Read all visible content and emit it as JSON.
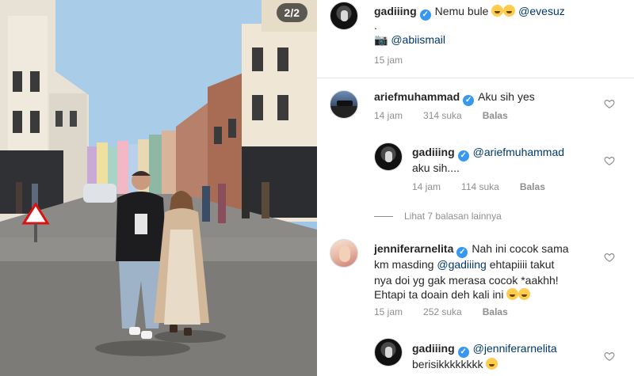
{
  "photo": {
    "counter": "2/2"
  },
  "post": {
    "username": "gadiiing",
    "caption_text": "Nemu bule",
    "caption_mention": "@evesuz",
    "dot": ".",
    "credit_mention": "@abiismail",
    "time": "15 jam"
  },
  "comments": [
    {
      "username": "ariefmuhammad",
      "text": "Aku sih yes",
      "time": "14 jam",
      "likes": "314 suka",
      "reply": "Balas",
      "replies": [
        {
          "username": "gadiiing",
          "mention": "@ariefmuhammad",
          "text": "aku sih....",
          "time": "14 jam",
          "likes": "114 suka",
          "reply": "Balas"
        }
      ],
      "view_more": "Lihat 7 balasan lainnya"
    },
    {
      "username": "jenniferarnelita",
      "text_line1": "Nah ini cocok sama",
      "text_line2_a": "km masding",
      "text_line2_mention": "@gadiiing",
      "text_line2_b": "ehtapiiii takut",
      "text_line3": "nya doi yg gak merasa cocok *aakhh!",
      "text_line4": "Ehtapi ta doain  deh kali ini",
      "time": "15 jam",
      "likes": "252 suka",
      "reply": "Balas",
      "replies": [
        {
          "username": "gadiiing",
          "mention": "@jenniferarnelita",
          "text": "berisikkkkkkkk"
        }
      ]
    }
  ],
  "icons": {
    "verified": "verified-badge-icon",
    "like": "heart-icon",
    "camera": "camera-icon",
    "emoji": "grinning-emoji-icon"
  },
  "colors": {
    "verified": "#3897f0",
    "mention": "#00376b",
    "meta": "#8e8e8e"
  }
}
